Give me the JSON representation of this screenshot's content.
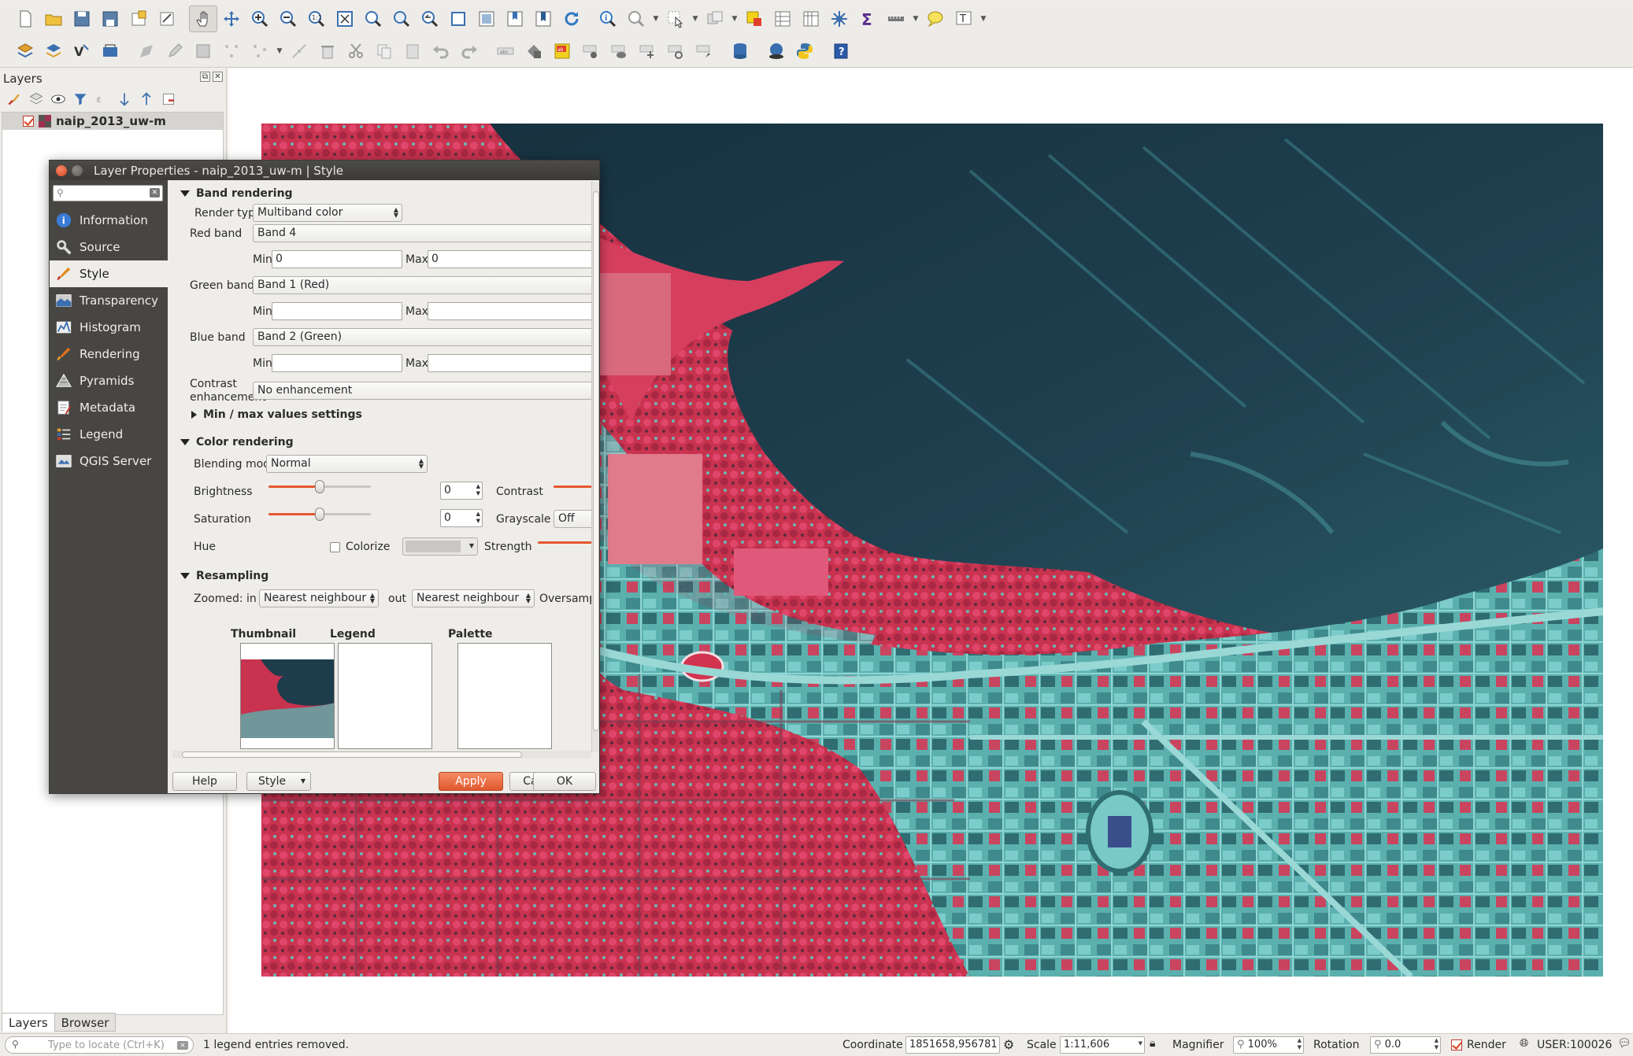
{
  "panel": {
    "title": "Layers",
    "layer_name": "naip_2013_uw-m",
    "tabs": [
      "Layers",
      "Browser"
    ]
  },
  "dialog": {
    "title": "Layer Properties - naip_2013_uw-m | Style",
    "sidebar": [
      {
        "label": "Information",
        "icon": "info-icon"
      },
      {
        "label": "Source",
        "icon": "wrench-icon"
      },
      {
        "label": "Style",
        "icon": "paintbrush-icon"
      },
      {
        "label": "Transparency",
        "icon": "transparency-icon"
      },
      {
        "label": "Histogram",
        "icon": "histogram-icon"
      },
      {
        "label": "Rendering",
        "icon": "brush-icon"
      },
      {
        "label": "Pyramids",
        "icon": "pyramid-icon"
      },
      {
        "label": "Metadata",
        "icon": "metadata-icon"
      },
      {
        "label": "Legend",
        "icon": "legend-icon"
      },
      {
        "label": "QGIS Server",
        "icon": "server-icon"
      }
    ],
    "active_item": "Style",
    "band_rendering": {
      "header": "Band rendering",
      "render_type_label": "Render type",
      "render_type_value": "Multiband color",
      "red_label": "Red band",
      "red_value": "Band 4",
      "red_min": "0",
      "red_max": "0",
      "green_label": "Green band",
      "green_value": "Band 1 (Red)",
      "green_min": "",
      "green_max": "",
      "blue_label": "Blue band",
      "blue_value": "Band 2 (Green)",
      "blue_min": "",
      "blue_max": "",
      "min_label": "Min",
      "max_label": "Max",
      "contrast_label_1": "Contrast",
      "contrast_label_2": "enhancement",
      "contrast_value": "No enhancement",
      "minmax_header": "Min / max values settings"
    },
    "color_rendering": {
      "header": "Color rendering",
      "blending_label": "Blending mode",
      "blending_value": "Normal",
      "brightness_label": "Brightness",
      "brightness_value": "0",
      "brightness_level": 0.5,
      "contrast_label": "Contrast",
      "saturation_label": "Saturation",
      "saturation_value": "0",
      "saturation_level": 0.5,
      "grayscale_label": "Grayscale",
      "grayscale_value": "Off",
      "hue_label": "Hue",
      "colorize_label": "Colorize",
      "strength_label": "Strength"
    },
    "resampling": {
      "header": "Resampling",
      "zoomed_in_label": "Zoomed: in",
      "zoomed_in_value": "Nearest neighbour",
      "out_label": "out",
      "out_value": "Nearest neighbour",
      "oversampling_label": "Oversampling"
    },
    "previews": {
      "thumbnail": "Thumbnail",
      "legend": "Legend",
      "palette": "Palette"
    },
    "buttons": {
      "help": "Help",
      "style": "Style",
      "apply": "Apply",
      "cancel": "Cancel",
      "ok": "OK"
    }
  },
  "status": {
    "locator_placeholder": "Type to locate (Ctrl+K)",
    "message": "1 legend entries removed.",
    "coordinate_label": "Coordinate",
    "coordinate_value": "1851658,956781",
    "scale_label": "Scale",
    "scale_value": "1:11,606",
    "magnifier_label": "Magnifier",
    "magnifier_value": "100%",
    "rotation_label": "Rotation",
    "rotation_value": "0.0",
    "render_label": "Render",
    "crs_label": "USER:100026"
  },
  "colors": {
    "accent": "#e4582f",
    "vegetation": "#d83a5a",
    "water": "#1d3c4c",
    "urban": "#5fb9b7",
    "sidebar": "#474642"
  }
}
